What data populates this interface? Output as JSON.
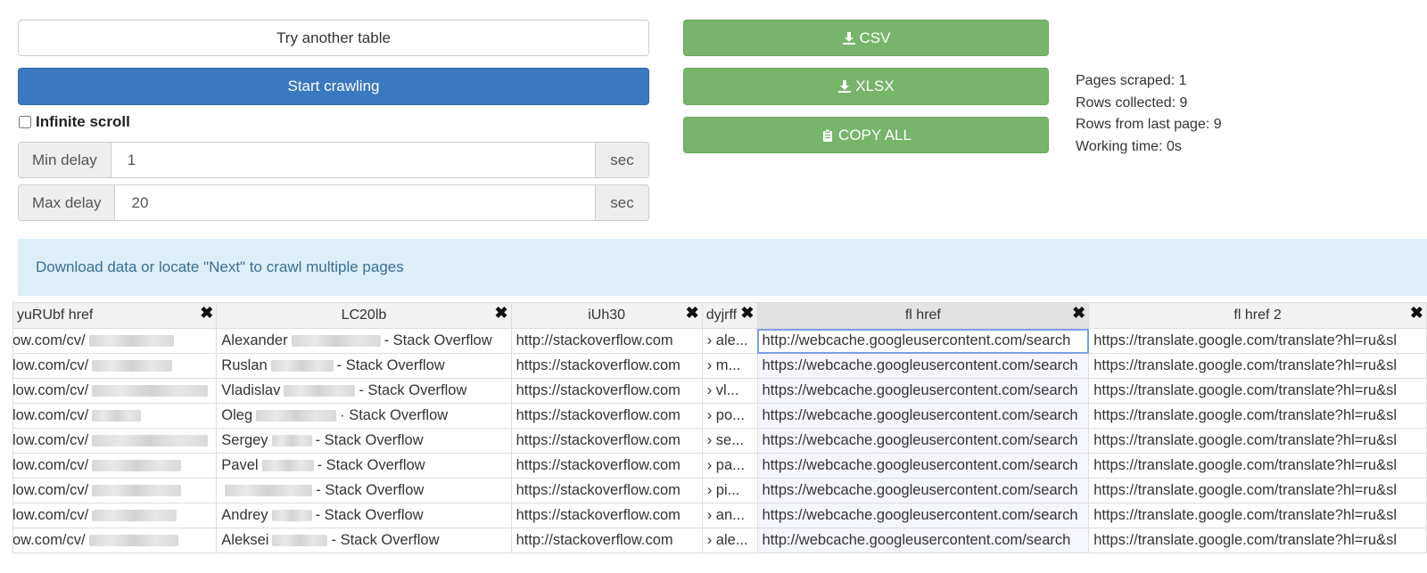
{
  "buttons": {
    "try_another": "Try another table",
    "start_crawling": "Start crawling",
    "csv": "CSV",
    "xlsx": "XLSX",
    "copy_all": "COPY ALL"
  },
  "options": {
    "infinite_scroll_label": "Infinite scroll",
    "infinite_scroll_checked": false,
    "min_delay": {
      "label": "Min delay",
      "value": "1",
      "unit": "sec"
    },
    "max_delay": {
      "label": "Max delay",
      "value": "20",
      "unit": "sec"
    }
  },
  "stats": {
    "pages_scraped": "Pages scraped: 1",
    "rows_collected": "Rows collected: 9",
    "rows_last_page": "Rows from last page: 9",
    "working_time": "Working time: 0s"
  },
  "alert": {
    "text": "Download data or locate \"Next\" to crawl multiple pages"
  },
  "table": {
    "columns": [
      "yuRUbf href",
      "LC20lb",
      "iUh30",
      "dyjrff",
      "fl href",
      "fl href 2"
    ],
    "close_glyph": "✖",
    "rows": [
      {
        "c1": "ow.com/cv/",
        "c2a": "Alexander",
        "c2b": "- Stack Overflow",
        "c3": "http://stackoverflow.com",
        "c4": "› ale...",
        "c5": "http://webcache.googleusercontent.com/search",
        "c6": "https://translate.google.com/translate?hl=ru&sl"
      },
      {
        "c1": "low.com/cv/",
        "c2a": "Ruslan",
        "c2b": "- Stack Overflow",
        "c3": "https://stackoverflow.com",
        "c4": "› m...",
        "c5": "https://webcache.googleusercontent.com/search",
        "c6": "https://translate.google.com/translate?hl=ru&sl"
      },
      {
        "c1": "low.com/cv/",
        "c2a": "Vladislav",
        "c2b": "- Stack Overflow",
        "c3": "https://stackoverflow.com",
        "c4": "› vl...",
        "c5": "https://webcache.googleusercontent.com/search",
        "c6": "https://translate.google.com/translate?hl=ru&sl"
      },
      {
        "c1": "low.com/cv/",
        "c2a": "Oleg",
        "c2b": "· Stack Overflow",
        "c3": "https://stackoverflow.com",
        "c4": "› po...",
        "c5": "https://webcache.googleusercontent.com/search",
        "c6": "https://translate.google.com/translate?hl=ru&sl"
      },
      {
        "c1": "low.com/cv/",
        "c2a": "Sergey",
        "c2b": "- Stack Overflow",
        "c3": "https://stackoverflow.com",
        "c4": "› se...",
        "c5": "https://webcache.googleusercontent.com/search",
        "c6": "https://translate.google.com/translate?hl=ru&sl"
      },
      {
        "c1": "low.com/cv/",
        "c2a": "Pavel",
        "c2b": "- Stack Overflow",
        "c3": "https://stackoverflow.com",
        "c4": "› pa...",
        "c5": "https://webcache.googleusercontent.com/search",
        "c6": "https://translate.google.com/translate?hl=ru&sl"
      },
      {
        "c1": "low.com/cv/",
        "c2a": "",
        "c2b": "- Stack Overflow",
        "c3": "https://stackoverflow.com",
        "c4": "› pi...",
        "c5": "https://webcache.googleusercontent.com/search",
        "c6": "https://translate.google.com/translate?hl=ru&sl"
      },
      {
        "c1": "low.com/cv/",
        "c2a": "Andrey",
        "c2b": "- Stack Overflow",
        "c3": "https://stackoverflow.com",
        "c4": "› an...",
        "c5": "https://webcache.googleusercontent.com/search",
        "c6": "https://translate.google.com/translate?hl=ru&sl"
      },
      {
        "c1": "ow.com/cv/",
        "c2a": "Aleksei",
        "c2b": "- Stack Overflow",
        "c3": "http://stackoverflow.com",
        "c4": "› ale...",
        "c5": "http://webcache.googleusercontent.com/search",
        "c6": "https://translate.google.com/translate?hl=ru&sl"
      }
    ]
  },
  "colors": {
    "primary": "#3a78c0",
    "success": "#77b56b",
    "alert_bg": "#dceef8"
  }
}
